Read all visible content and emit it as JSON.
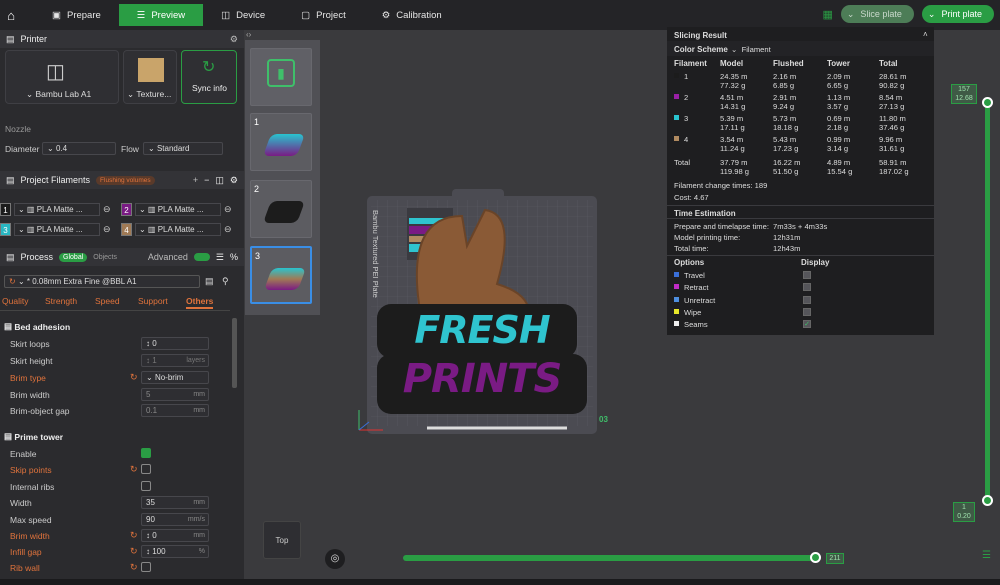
{
  "topbar": {
    "tabs": [
      "Prepare",
      "Preview",
      "Device",
      "Project",
      "Calibration"
    ],
    "slice_label": "Slice plate",
    "print_label": "Print plate"
  },
  "printer": {
    "title": "Printer",
    "name": "Bambu Lab A1",
    "plate": "Texture...",
    "sync": "Sync info",
    "nozzle_label": "Nozzle",
    "diameter_label": "Diameter",
    "diameter": "0.4",
    "flow_label": "Flow",
    "flow": "Standard"
  },
  "filaments": {
    "title": "Project Filaments",
    "flushing": "Flushing volumes",
    "items": [
      {
        "n": "1",
        "name": "PLA Matte ...",
        "color": "#1c1c1c"
      },
      {
        "n": "2",
        "name": "PLA Matte ...",
        "color": "#7a1b84"
      },
      {
        "n": "3",
        "name": "PLA Matte ...",
        "color": "#29b7c2"
      },
      {
        "n": "4",
        "name": "PLA Matte ...",
        "color": "#a07a55"
      }
    ]
  },
  "process": {
    "title": "Process",
    "global": "Global",
    "objects": "Objects",
    "advanced": "Advanced",
    "profile": "* 0.08mm Extra Fine @BBL A1",
    "tabs": [
      "Quality",
      "Strength",
      "Speed",
      "Support",
      "Others"
    ]
  },
  "bed": {
    "title": "Bed adhesion",
    "skirt_loops": "Skirt loops",
    "skirt_loops_v": "0",
    "skirt_height": "Skirt height",
    "skirt_height_v": "1",
    "layers": "layers",
    "brim_type": "Brim type",
    "brim_type_v": "No-brim",
    "brim_width": "Brim width",
    "brim_width_v": "5",
    "brim_gap": "Brim-object gap",
    "brim_gap_v": "0.1",
    "mm": "mm"
  },
  "prime": {
    "title": "Prime tower",
    "enable": "Enable",
    "skip": "Skip points",
    "ribs": "Internal ribs",
    "width": "Width",
    "width_v": "35",
    "speed": "Max speed",
    "speed_v": "90",
    "mms": "mm/s",
    "brim_width": "Brim width",
    "brim_width_v": "0",
    "infill": "Infill gap",
    "infill_v": "100",
    "pct": "%",
    "rib": "Rib wall"
  },
  "thumbs": [
    "1",
    "2",
    "3"
  ],
  "viewport": {
    "top_label": "Top",
    "plate_text": "Bambu Textured PEI Plate",
    "num": "03"
  },
  "art": {
    "word1": "FRESH",
    "word2": "PRINTS"
  },
  "slicing": {
    "title": "Slicing Result",
    "scheme_label": "Color Scheme",
    "scheme": "Filament",
    "headers": [
      "Filament",
      "Model",
      "Flushed",
      "Tower",
      "Total"
    ],
    "rows": [
      {
        "n": "1",
        "c": "#1c1c1c",
        "model": [
          "24.35 m",
          "77.32 g"
        ],
        "flushed": [
          "2.16 m",
          "6.85 g"
        ],
        "tower": [
          "2.09 m",
          "6.65 g"
        ],
        "total": [
          "28.61 m",
          "90.82 g"
        ]
      },
      {
        "n": "2",
        "c": "#9a1fa6",
        "model": [
          "4.51 m",
          "14.31 g"
        ],
        "flushed": [
          "2.91 m",
          "9.24 g"
        ],
        "tower": [
          "1.13 m",
          "3.57 g"
        ],
        "total": [
          "8.54 m",
          "27.13 g"
        ]
      },
      {
        "n": "3",
        "c": "#29c4cf",
        "model": [
          "5.39 m",
          "17.11 g"
        ],
        "flushed": [
          "5.73 m",
          "18.18 g"
        ],
        "tower": [
          "0.69 m",
          "2.18 g"
        ],
        "total": [
          "11.80 m",
          "37.46 g"
        ]
      },
      {
        "n": "4",
        "c": "#b08a60",
        "model": [
          "3.54 m",
          "11.24 g"
        ],
        "flushed": [
          "5.43 m",
          "17.23 g"
        ],
        "tower": [
          "0.99 m",
          "3.14 g"
        ],
        "total": [
          "9.96 m",
          "31.61 g"
        ]
      }
    ],
    "total": {
      "label": "Total",
      "model": [
        "37.79 m",
        "119.98 g"
      ],
      "flushed": [
        "16.22 m",
        "51.50 g"
      ],
      "tower": [
        "4.89 m",
        "15.54 g"
      ],
      "total": [
        "58.91 m",
        "187.02 g"
      ]
    },
    "change_label": "Filament change times:",
    "change": "189",
    "cost_label": "Cost:",
    "cost": "4.67",
    "time_title": "Time Estimation",
    "prep_label": "Prepare and timelapse time:",
    "prep": "7m33s + 4m33s",
    "model_time_label": "Model printing time:",
    "model_time": "12h31m",
    "total_time_label": "Total time:",
    "total_time": "12h43m",
    "options_label": "Options",
    "display_label": "Display",
    "options": [
      {
        "name": "Travel",
        "c": "#3a6fd8"
      },
      {
        "name": "Retract",
        "c": "#c12bc6"
      },
      {
        "name": "Unretract",
        "c": "#4e8fe0"
      },
      {
        "name": "Wipe",
        "c": "#e8e82a"
      },
      {
        "name": "Seams",
        "c": "#eeeeee"
      }
    ]
  },
  "vslider": {
    "top_a": "157",
    "top_b": "12.68",
    "bot_a": "1",
    "bot_b": "0.20"
  },
  "hslider": {
    "val": "211"
  }
}
